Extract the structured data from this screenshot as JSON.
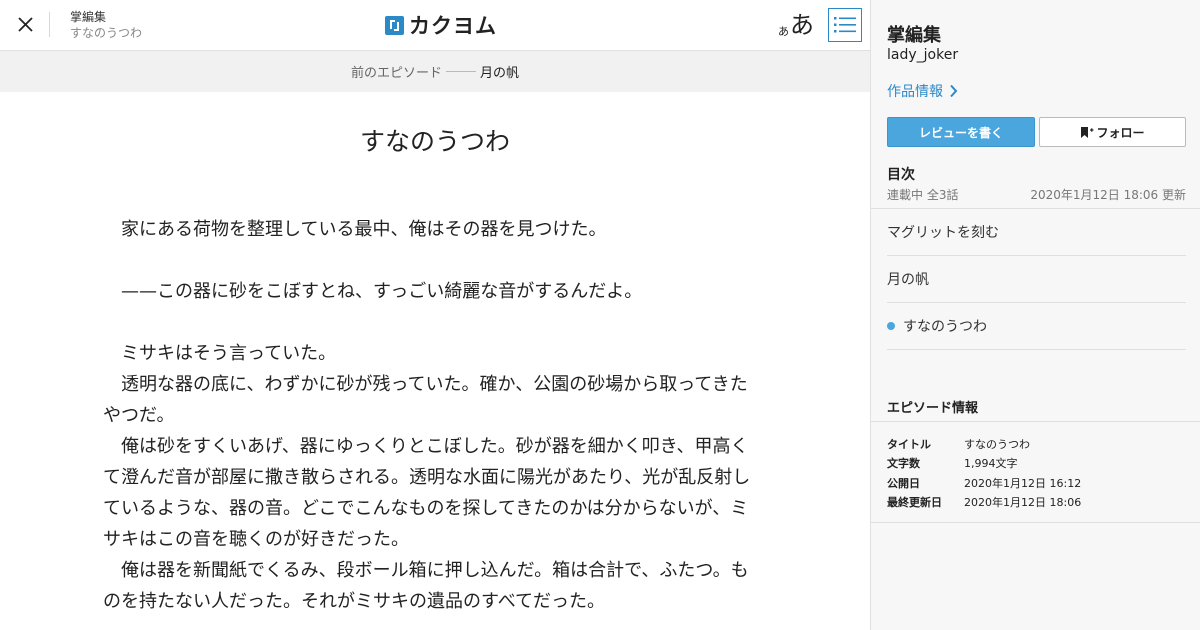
{
  "header": {
    "author": "掌編集",
    "work_title": "すなのうつわ",
    "logo_text": "カクヨム",
    "font_toggle_small": "あ",
    "font_toggle_large": "あ"
  },
  "prev_episode": {
    "label": "前のエピソード",
    "title": "月の帆"
  },
  "episode": {
    "title": "すなのうつわ",
    "paragraphs": [
      "家にある荷物を整理している最中、俺はその器を見つけた。",
      "",
      "——この器に砂をこぼすとね、すっごい綺麗な音がするんだよ。",
      "",
      "ミサキはそう言っていた。",
      "透明な器の底に、わずかに砂が残っていた。確か、公園の砂場から取ってきたやつだ。",
      "俺は砂をすくいあげ、器にゆっくりとこぼした。砂が器を細かく叩き、甲高くて澄んだ音が部屋に撒き散らされる。透明な水面に陽光があたり、光が乱反射しているような、器の音。どこでこんなものを探してきたのかは分からないが、ミサキはこの音を聴くのが好きだった。",
      "俺は器を新聞紙でくるみ、段ボール箱に押し込んだ。箱は合計で、ふたつ。ものを持たない人だった。それがミサキの遺品のすべてだった。"
    ]
  },
  "sidebar": {
    "work_title": "掌編集",
    "author": "lady_joker",
    "info_link": "作品情報",
    "review_button": "レビューを書く",
    "follow_button": "フォロー",
    "toc_heading": "目次",
    "toc_status": "連載中 全3話",
    "toc_updated": "2020年1月12日 18:06 更新",
    "toc_items": [
      "マグリットを刻む",
      "月の帆",
      "すなのうつわ"
    ],
    "episode_info_heading": "エピソード情報",
    "episode_info": [
      {
        "key": "タイトル",
        "value": "すなのうつわ"
      },
      {
        "key": "文字数",
        "value": "1,994文字"
      },
      {
        "key": "公開日",
        "value": "2020年1月12日 16:12"
      },
      {
        "key": "最終更新日",
        "value": "2020年1月12日 18:06"
      }
    ]
  },
  "colors": {
    "accent": "#2b89c8",
    "button_blue": "#4ba6dd",
    "prev_bar_bg": "#f1f1f1",
    "sidebar_bg": "#f7f7f7"
  },
  "icons": [
    "close-icon",
    "kakuyomu-logo-icon",
    "toc-list-icon",
    "chevron-right-icon",
    "bookmark-plus-icon",
    "current-episode-dot-icon"
  ]
}
